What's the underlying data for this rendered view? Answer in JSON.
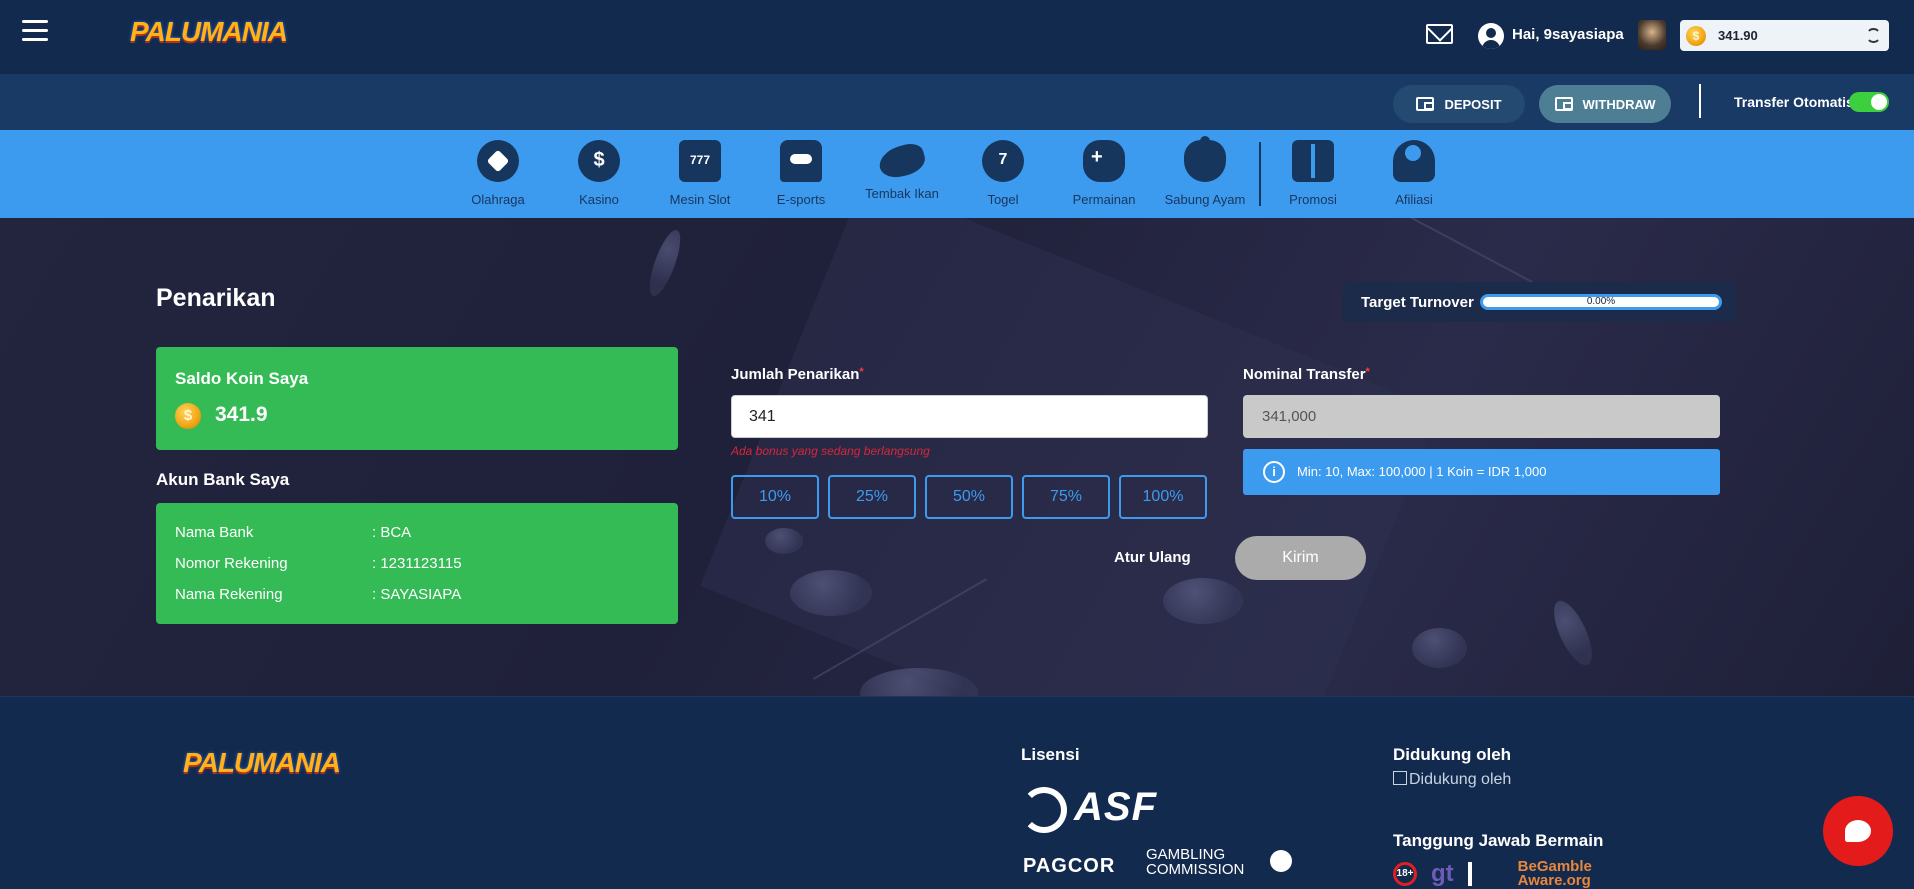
{
  "header": {
    "logo_text": "PALUMANIA",
    "greeting": "Hai, 9sayasiapa",
    "balance": "341.90"
  },
  "actions": {
    "deposit_label": "DEPOSIT",
    "withdraw_label": "WITHDRAW",
    "auto_transfer_label": "Transfer Otomatis",
    "auto_transfer_on": true
  },
  "categories": [
    {
      "label": "Olahraga",
      "icon": "soccer-ball-icon"
    },
    {
      "label": "Kasino",
      "icon": "casino-chip-icon"
    },
    {
      "label": "Mesin Slot",
      "icon": "slot-machine-icon"
    },
    {
      "label": "E-sports",
      "icon": "esports-icon"
    },
    {
      "label": "Tembak Ikan",
      "icon": "fish-icon"
    },
    {
      "label": "Togel",
      "icon": "lottery-balls-icon"
    },
    {
      "label": "Permainan",
      "icon": "gamepad-icon"
    },
    {
      "label": "Sabung Ayam",
      "icon": "rooster-icon"
    },
    {
      "label": "Promosi",
      "icon": "gift-icon"
    },
    {
      "label": "Afiliasi",
      "icon": "affiliate-users-icon"
    }
  ],
  "withdraw": {
    "title": "Penarikan",
    "turnover_label": "Target Turnover",
    "turnover_value": "0.00%",
    "saldo_title": "Saldo Koin Saya",
    "saldo_value": "341.9",
    "bank_title": "Akun Bank Saya",
    "bank_rows": [
      {
        "key": "Nama Bank",
        "value": ": BCA"
      },
      {
        "key": "Nomor Rekening",
        "value": ": 1231123115"
      },
      {
        "key": "Nama Rekening",
        "value": ": SAYASIAPA"
      }
    ],
    "amount_label": "Jumlah Penarikan",
    "amount_value": "341",
    "bonus_note": "Ada bonus yang sedang berlangsung",
    "percent_options": [
      "10%",
      "25%",
      "50%",
      "75%",
      "100%"
    ],
    "nominal_label": "Nominal Transfer",
    "nominal_value": "341,000",
    "info_text": "Min: 10, Max: 100,000 | 1 Koin = IDR 1,000",
    "required_mark": "*",
    "reset_label": "Atur Ulang",
    "submit_label": "Kirim"
  },
  "footer": {
    "logo_text": "PALUMANIA",
    "license_title": "Lisensi",
    "asf_text": "ASF",
    "pagcor_text": "PAGCOR",
    "gambling_commission_text": "GAMBLING COMMISSION",
    "supported_title": "Didukung oleh",
    "supported_alt": "Didukung oleh",
    "responsible_title": "Tanggung Jawab Bermain",
    "badge_18": "18+",
    "badge_gt": "gt",
    "badge_begamble": "BeGamble Aware.org"
  },
  "colors": {
    "header_bg": "#132a4f",
    "category_bar": "#3d9bef",
    "green_card": "#34bb56",
    "chat_button": "#e31b1b"
  }
}
